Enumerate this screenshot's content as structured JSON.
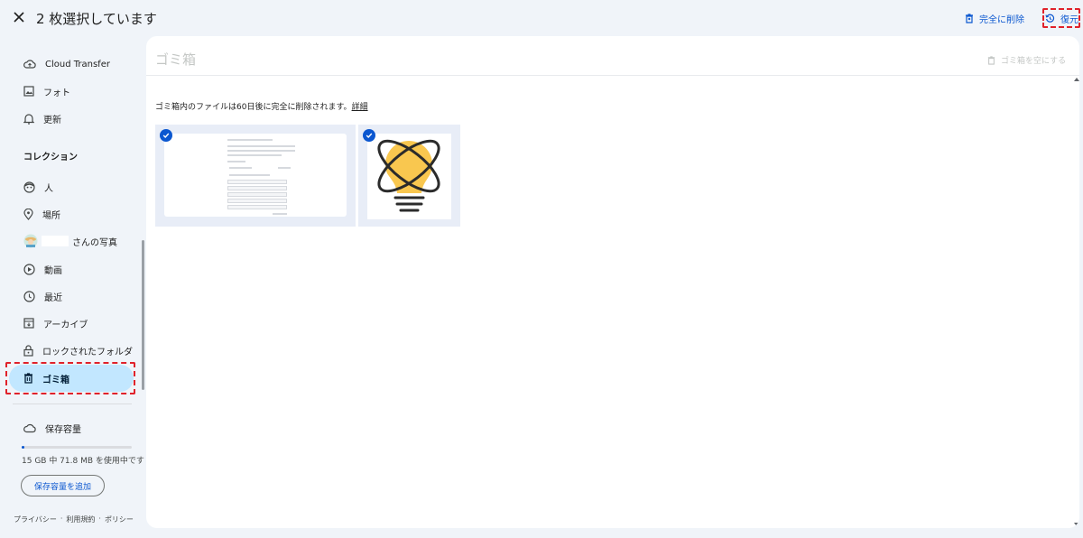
{
  "topbar": {
    "selection_title": "2 枚選択しています",
    "delete_forever_label": "完全に削除",
    "restore_label": "復元"
  },
  "sidebar": {
    "items_top": [
      {
        "label": "Cloud Transfer",
        "icon": "cloud-transfer-icon"
      },
      {
        "label": "フォト",
        "icon": "photo-icon"
      },
      {
        "label": "更新",
        "icon": "bell-icon"
      }
    ],
    "collections_title": "コレクション",
    "items_collections": [
      {
        "label": "人",
        "icon": "face-icon"
      },
      {
        "label": "場所",
        "icon": "location-pin-icon"
      },
      {
        "label": "さんの写真",
        "icon": "user-avatar-icon"
      },
      {
        "label": "動画",
        "icon": "play-circle-icon"
      },
      {
        "label": "最近",
        "icon": "clock-icon"
      },
      {
        "label": "アーカイブ",
        "icon": "archive-icon"
      },
      {
        "label": "ロックされたフォルダ",
        "icon": "lock-icon"
      },
      {
        "label": "ゴミ箱",
        "icon": "trash-icon",
        "active": true
      }
    ],
    "storage": {
      "label": "保存容量",
      "usage_text": "15 GB 中 71.8 MB を使用中です",
      "used_fraction": 0.005,
      "add_button": "保存容量を追加"
    },
    "footer": {
      "privacy": "プライバシー",
      "sep": "·",
      "terms": "利用規約",
      "policy": "ポリシー"
    }
  },
  "main": {
    "title": "ゴミ箱",
    "empty_trash_label": "ゴミ箱を空にする",
    "notice_text": "ゴミ箱内のファイルは60日後に完全に削除されます。",
    "notice_link": "詳細",
    "items": [
      {
        "type": "document-screenshot",
        "selected": true
      },
      {
        "type": "lightbulb-illustration",
        "selected": true
      }
    ]
  },
  "colors": {
    "accent": "#0b57d0",
    "active_bg": "#c2e7ff",
    "page_bg": "#f0f4f9",
    "highlight": "#e0222b",
    "bulb_yellow": "#f9c74f"
  }
}
